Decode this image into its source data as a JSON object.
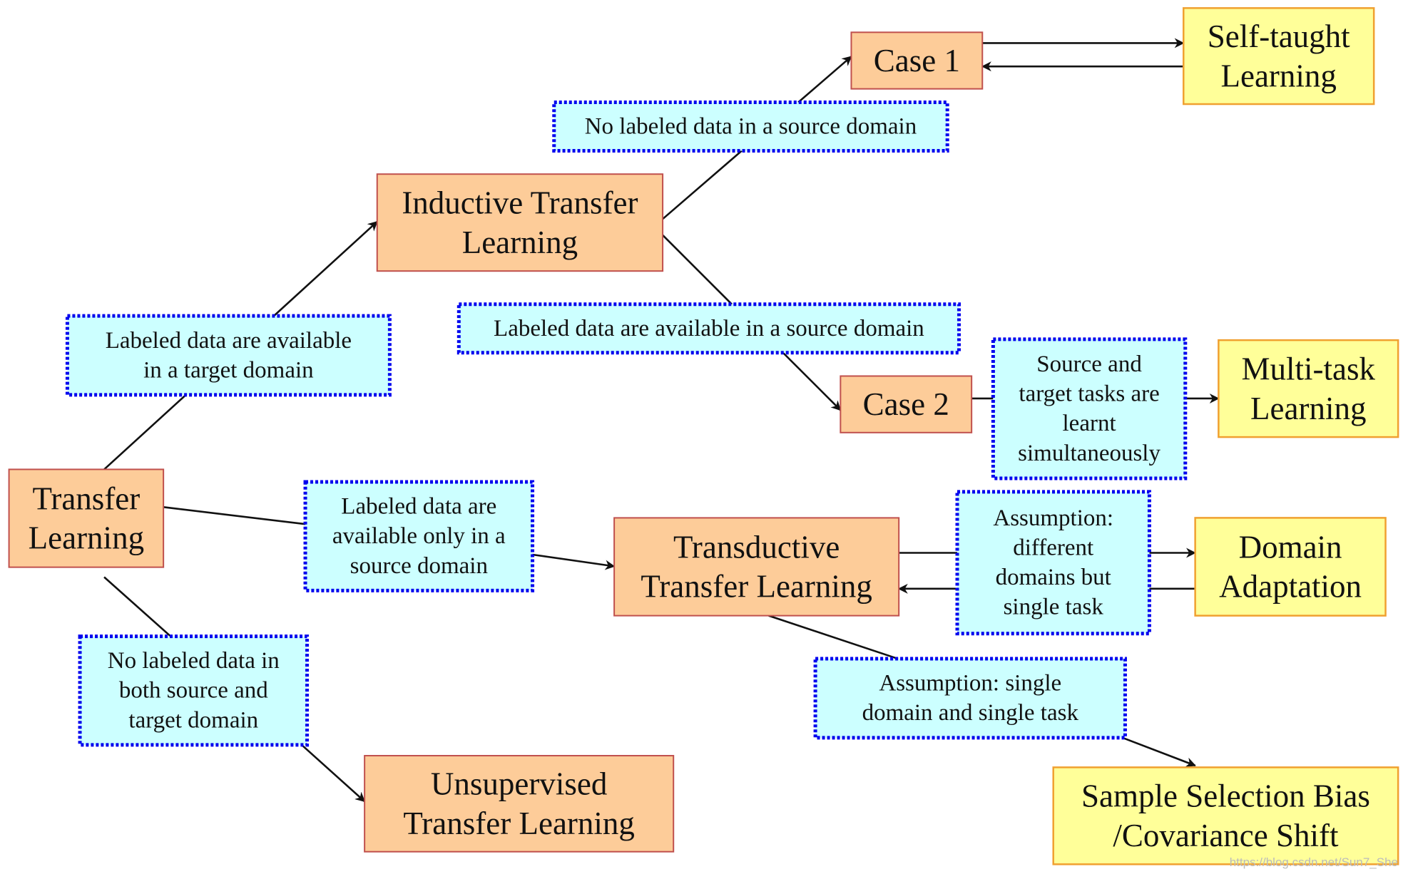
{
  "colors": {
    "method_fill": "#fdcc99",
    "method_stroke": "#c0504d",
    "setting_fill": "#ffff99",
    "setting_stroke": "#f0a030",
    "condition_fill": "#ccffff",
    "condition_stroke": "#0000ee",
    "edge": "#111111"
  },
  "nodes": {
    "transfer_learning": {
      "lines": [
        "Transfer",
        "Learning"
      ]
    },
    "inductive": {
      "lines": [
        "Inductive Transfer",
        "Learning"
      ]
    },
    "transductive": {
      "lines": [
        "Transductive",
        "Transfer Learning"
      ]
    },
    "unsupervised": {
      "lines": [
        "Unsupervised",
        "Transfer Learning"
      ]
    },
    "case1": {
      "lines": [
        "Case 1"
      ]
    },
    "case2": {
      "lines": [
        "Case 2"
      ]
    },
    "self_taught": {
      "lines": [
        "Self-taught",
        "Learning"
      ]
    },
    "multi_task": {
      "lines": [
        "Multi-task",
        "Learning"
      ]
    },
    "domain_adaptation": {
      "lines": [
        "Domain",
        "Adaptation"
      ]
    },
    "sample_selection": {
      "lines": [
        "Sample Selection Bias",
        "/Covariance Shift"
      ]
    }
  },
  "conditions": {
    "labeled_target": {
      "lines": [
        "Labeled data are available",
        "in a target domain"
      ]
    },
    "labeled_source_only": {
      "lines": [
        "Labeled data are",
        "available only in a",
        "source domain"
      ]
    },
    "no_labeled_both": {
      "lines": [
        "No labeled data in",
        "both source and",
        "target domain"
      ]
    },
    "no_labeled_source": {
      "lines": [
        "No labeled data in a source domain"
      ]
    },
    "labeled_source": {
      "lines": [
        "Labeled data are available in a source domain"
      ]
    },
    "simultaneous": {
      "lines": [
        "Source and",
        "target tasks are",
        "learnt",
        "simultaneously"
      ]
    },
    "different_domains": {
      "lines": [
        "Assumption:",
        "different",
        "domains but",
        "single task"
      ]
    },
    "single_domain": {
      "lines": [
        "Assumption: single",
        "domain and single task"
      ]
    }
  },
  "watermark": "https://blog.csdn.net/Sun7_She"
}
